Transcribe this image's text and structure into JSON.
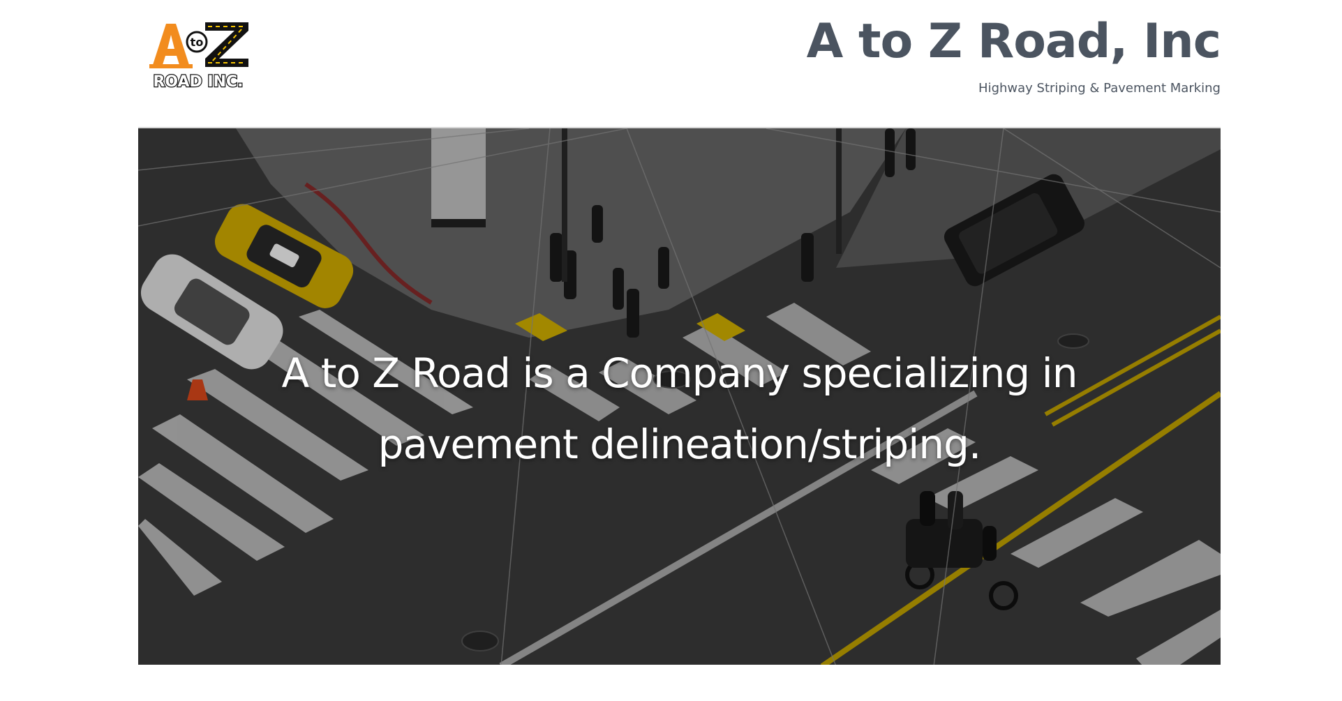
{
  "header": {
    "logo": {
      "alt_text": "A to Z ROAD INC.",
      "parts": {
        "a": "A",
        "to": "to",
        "z": "Z",
        "sub": "ROAD INC."
      },
      "colors": {
        "orange": "#f28c1e",
        "black": "#111111",
        "yellow": "#f5c400"
      }
    },
    "title": "A to Z Road, Inc",
    "tagline": "Highway Striping & Pavement Marking"
  },
  "hero": {
    "headline": "A to Z Road is a Company specializing in pavement delineation/striping."
  },
  "colors": {
    "title": "#4b5460",
    "hero_text": "#ffffff",
    "divider": "#d6d6d6"
  }
}
